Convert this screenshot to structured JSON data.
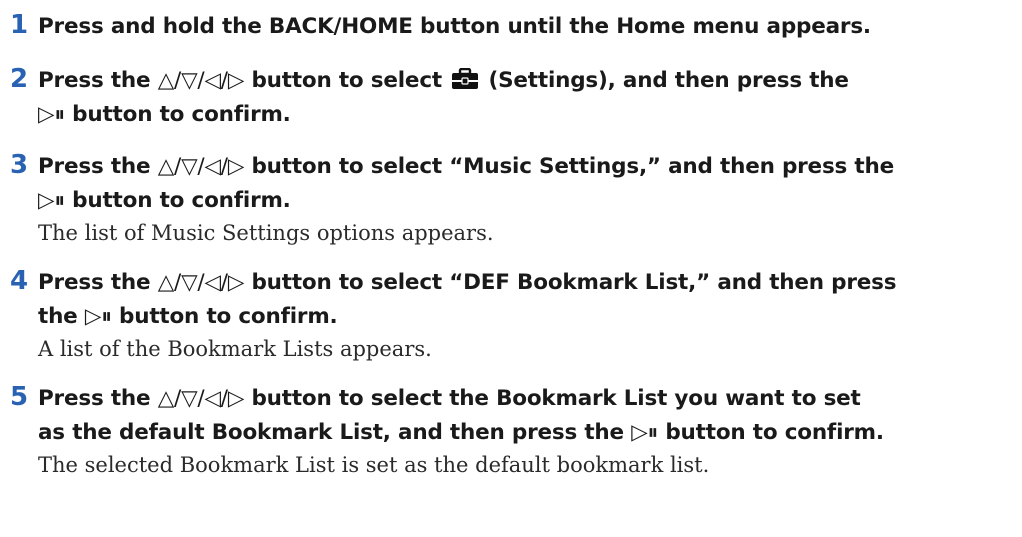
{
  "steps": [
    {
      "num": "1",
      "text": "Press and hold the BACK/HOME button until the Home menu appears."
    },
    {
      "num": "2",
      "before": "Press the ",
      "dirs": "△/▽/◁/▷",
      "mid": " button to select ",
      "icon": "toolbox-icon",
      "after": " (Settings), and then press the",
      "play": "▷⏸",
      "tail": " button to confirm."
    },
    {
      "num": "3",
      "before": "Press the ",
      "dirs": "△/▽/◁/▷",
      "after": " button to select “Music Settings,” and then press the",
      "play": "▷⏸",
      "tail": " button to confirm.",
      "note": "The list of Music Settings options appears."
    },
    {
      "num": "4",
      "before": "Press the ",
      "dirs": "△/▽/◁/▷",
      "after": " button to select “DEF Bookmark List,” and then press",
      "line2": "the ",
      "play": "▷⏸",
      "tail": " button to confirm.",
      "note": "A list of the Bookmark Lists appears."
    },
    {
      "num": "5",
      "before": "Press the ",
      "dirs": "△/▽/◁/▷",
      "after": " button to select the Bookmark List you want to set",
      "line2": "as the default Bookmark List, and then press the ",
      "play": "▷⏸",
      "tail": " button to confirm.",
      "note": "The selected Bookmark List is set as the default bookmark list."
    }
  ],
  "colors": {
    "step_number": "#2a62b3",
    "text": "#1a1a1a"
  }
}
